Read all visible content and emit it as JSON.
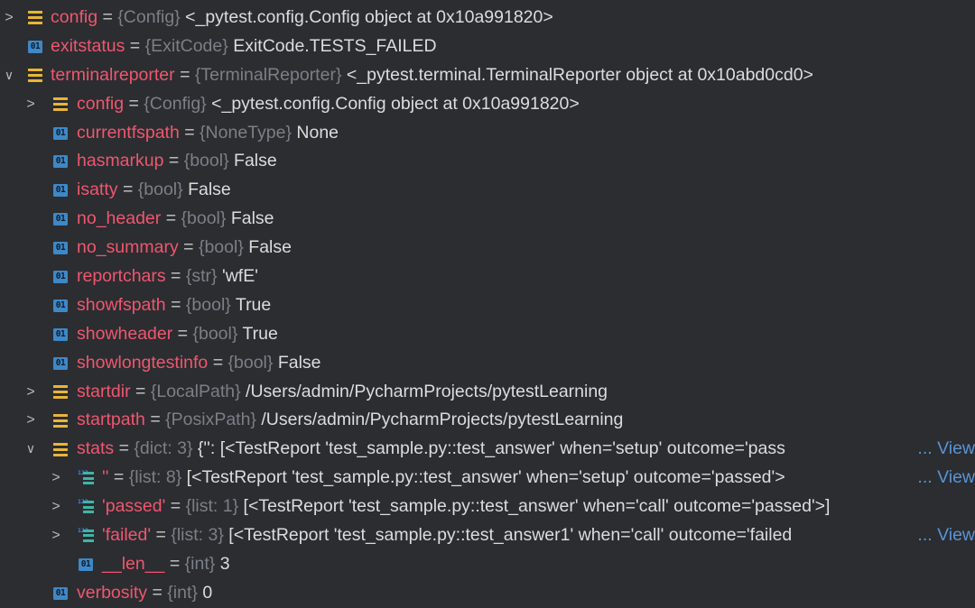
{
  "colors": {
    "background": "#2b2d31",
    "variable_name": "#f0566e",
    "type_annotation": "#7b7f86",
    "value_text": "#dcdcdc",
    "field_icon": "#e9b538",
    "primitive_icon": "#3e88c7",
    "list_icon": "#3fb5a6",
    "view_link": "#5a93d6"
  },
  "variables": [
    {
      "depth": 0,
      "arrow": ">",
      "icon": "field-icon",
      "name": "config",
      "eq": "=",
      "type": "{Config}",
      "value": "<_pytest.config.Config object at 0x10a991820>",
      "view": ""
    },
    {
      "depth": 0,
      "arrow": "",
      "icon": "primitive-icon",
      "name": "exitstatus",
      "eq": "=",
      "type": "{ExitCode}",
      "value": "ExitCode.TESTS_FAILED",
      "view": ""
    },
    {
      "depth": 0,
      "arrow": "∨",
      "icon": "field-icon",
      "name": "terminalreporter",
      "eq": "=",
      "type": "{TerminalReporter}",
      "value": "<_pytest.terminal.TerminalReporter object at 0x10abd0cd0>",
      "view": ""
    },
    {
      "depth": 1,
      "arrow": ">",
      "icon": "field-icon",
      "name": "config",
      "eq": "=",
      "type": "{Config}",
      "value": "<_pytest.config.Config object at 0x10a991820>",
      "view": ""
    },
    {
      "depth": 1,
      "arrow": "",
      "icon": "primitive-icon",
      "name": "currentfspath",
      "eq": "=",
      "type": "{NoneType}",
      "value": "None",
      "view": ""
    },
    {
      "depth": 1,
      "arrow": "",
      "icon": "primitive-icon",
      "name": "hasmarkup",
      "eq": "=",
      "type": "{bool}",
      "value": "False",
      "view": ""
    },
    {
      "depth": 1,
      "arrow": "",
      "icon": "primitive-icon",
      "name": "isatty",
      "eq": "=",
      "type": "{bool}",
      "value": "False",
      "view": ""
    },
    {
      "depth": 1,
      "arrow": "",
      "icon": "primitive-icon",
      "name": "no_header",
      "eq": "=",
      "type": "{bool}",
      "value": "False",
      "view": ""
    },
    {
      "depth": 1,
      "arrow": "",
      "icon": "primitive-icon",
      "name": "no_summary",
      "eq": "=",
      "type": "{bool}",
      "value": "False",
      "view": ""
    },
    {
      "depth": 1,
      "arrow": "",
      "icon": "primitive-icon",
      "name": "reportchars",
      "eq": "=",
      "type": "{str}",
      "value": "'wfE'",
      "view": ""
    },
    {
      "depth": 1,
      "arrow": "",
      "icon": "primitive-icon",
      "name": "showfspath",
      "eq": "=",
      "type": "{bool}",
      "value": "True",
      "view": ""
    },
    {
      "depth": 1,
      "arrow": "",
      "icon": "primitive-icon",
      "name": "showheader",
      "eq": "=",
      "type": "{bool}",
      "value": "True",
      "view": ""
    },
    {
      "depth": 1,
      "arrow": "",
      "icon": "primitive-icon",
      "name": "showlongtestinfo",
      "eq": "=",
      "type": "{bool}",
      "value": "False",
      "view": ""
    },
    {
      "depth": 1,
      "arrow": ">",
      "icon": "field-icon",
      "name": "startdir",
      "eq": "=",
      "type": "{LocalPath}",
      "value": "/Users/admin/PycharmProjects/pytestLearning",
      "view": ""
    },
    {
      "depth": 1,
      "arrow": ">",
      "icon": "field-icon",
      "name": "startpath",
      "eq": "=",
      "type": "{PosixPath}",
      "value": "/Users/admin/PycharmProjects/pytestLearning",
      "view": ""
    },
    {
      "depth": 1,
      "arrow": "∨",
      "icon": "field-icon",
      "name": "stats",
      "eq": "=",
      "type": "{dict: 3}",
      "value": "{'': [<TestReport 'test_sample.py::test_answer' when='setup' outcome='pass",
      "view": "... View"
    },
    {
      "depth": 2,
      "arrow": ">",
      "icon": "list-icon",
      "name": "''",
      "eq": "=",
      "type": "{list: 8}",
      "value": "[<TestReport 'test_sample.py::test_answer' when='setup' outcome='passed'>",
      "view": "... View"
    },
    {
      "depth": 2,
      "arrow": ">",
      "icon": "list-icon",
      "name": "'passed'",
      "eq": "=",
      "type": "{list: 1}",
      "value": "[<TestReport 'test_sample.py::test_answer' when='call' outcome='passed'>]",
      "view": ""
    },
    {
      "depth": 2,
      "arrow": ">",
      "icon": "list-icon",
      "name": "'failed'",
      "eq": "=",
      "type": "{list: 3}",
      "value": "[<TestReport 'test_sample.py::test_answer1' when='call' outcome='failed",
      "view": "... View"
    },
    {
      "depth": 2,
      "arrow": "",
      "icon": "primitive-icon",
      "name": "__len__",
      "eq": "=",
      "type": "{int}",
      "value": "3",
      "view": ""
    },
    {
      "depth": 1,
      "arrow": "",
      "icon": "primitive-icon",
      "name": "verbosity",
      "eq": "=",
      "type": "{int}",
      "value": "0",
      "view": ""
    }
  ],
  "icon_glyphs": {
    "primitive-icon": "01",
    "list-icon": "123"
  }
}
